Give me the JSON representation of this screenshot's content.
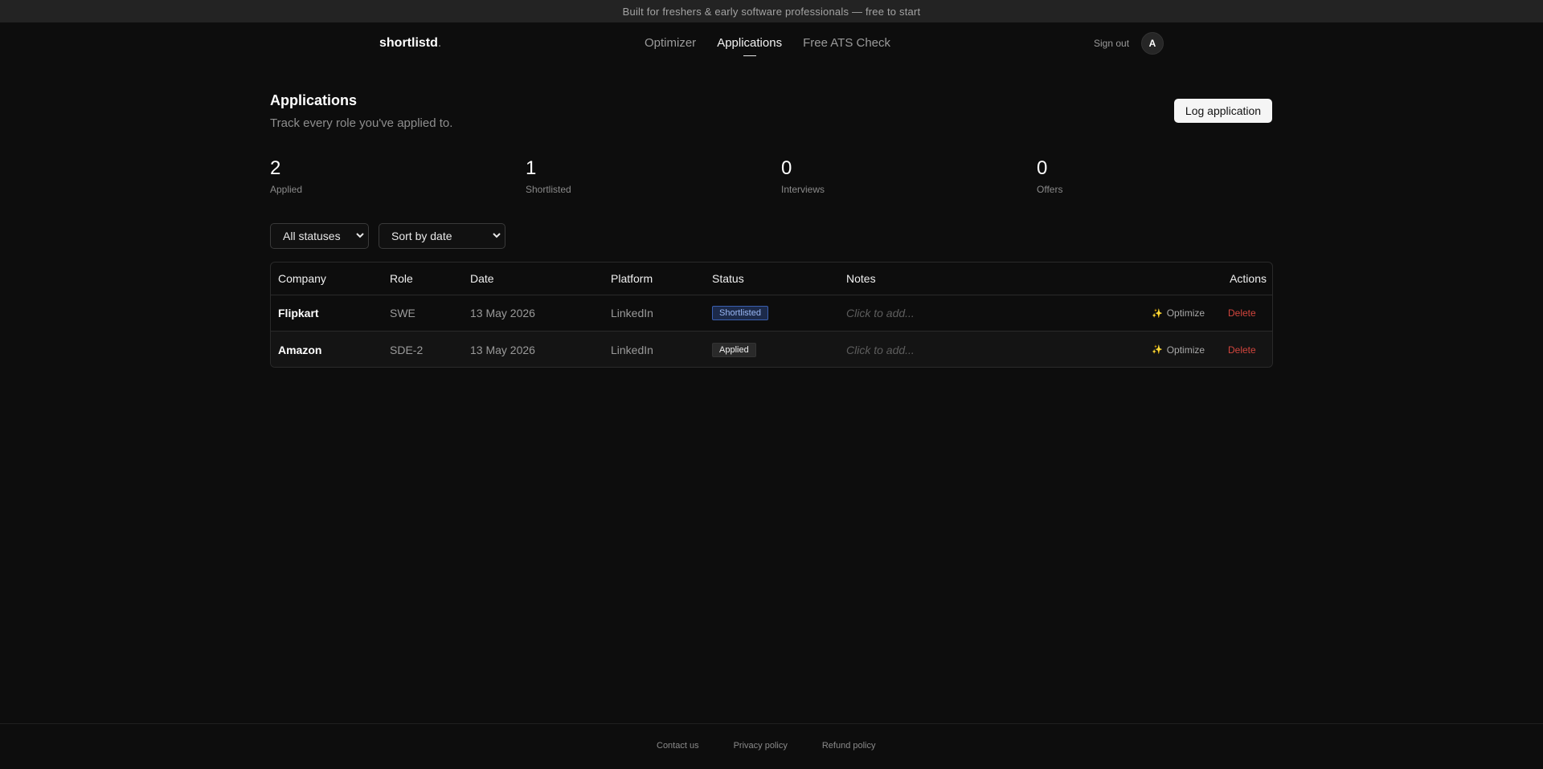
{
  "banner": "Built for freshers & early software professionals — free to start",
  "nav": {
    "logo": "shortlistd",
    "logo_dot": ".",
    "links": [
      "Optimizer",
      "Applications",
      "Free ATS Check"
    ],
    "active": "Applications",
    "signout": "Sign out",
    "avatar": "A"
  },
  "header": {
    "title": "Applications",
    "subtitle": "Track every role you've applied to.",
    "log_button": "Log application"
  },
  "stats": [
    {
      "value": "2",
      "label": "Applied"
    },
    {
      "value": "1",
      "label": "Shortlisted"
    },
    {
      "value": "0",
      "label": "Interviews"
    },
    {
      "value": "0",
      "label": "Offers"
    }
  ],
  "filters": {
    "status": "All statuses",
    "sort": "Sort by date"
  },
  "table": {
    "headers": [
      "Company",
      "Role",
      "Date",
      "Platform",
      "Status",
      "Notes",
      "Actions"
    ],
    "rows": [
      {
        "company": "Flipkart",
        "role": "SWE",
        "date": "13 May 2026",
        "platform": "LinkedIn",
        "status": "Shortlisted",
        "notes": "Click to add...",
        "optimize": "Optimize",
        "delete": "Delete"
      },
      {
        "company": "Amazon",
        "role": "SDE-2",
        "date": "13 May 2026",
        "platform": "LinkedIn",
        "status": "Applied",
        "notes": "Click to add...",
        "optimize": "Optimize",
        "delete": "Delete"
      }
    ]
  },
  "footer": {
    "links": [
      "Contact us",
      "Privacy policy",
      "Refund policy"
    ]
  },
  "colors": {
    "background": "#0d0d0d",
    "banner": "#232323",
    "shortlisted_badge": "#3a5fb0",
    "delete": "#d2453d",
    "spark": "#d7a640"
  },
  "icons": {
    "sparkle": "sparkle-icon",
    "chevron": "chevron-down-icon"
  }
}
